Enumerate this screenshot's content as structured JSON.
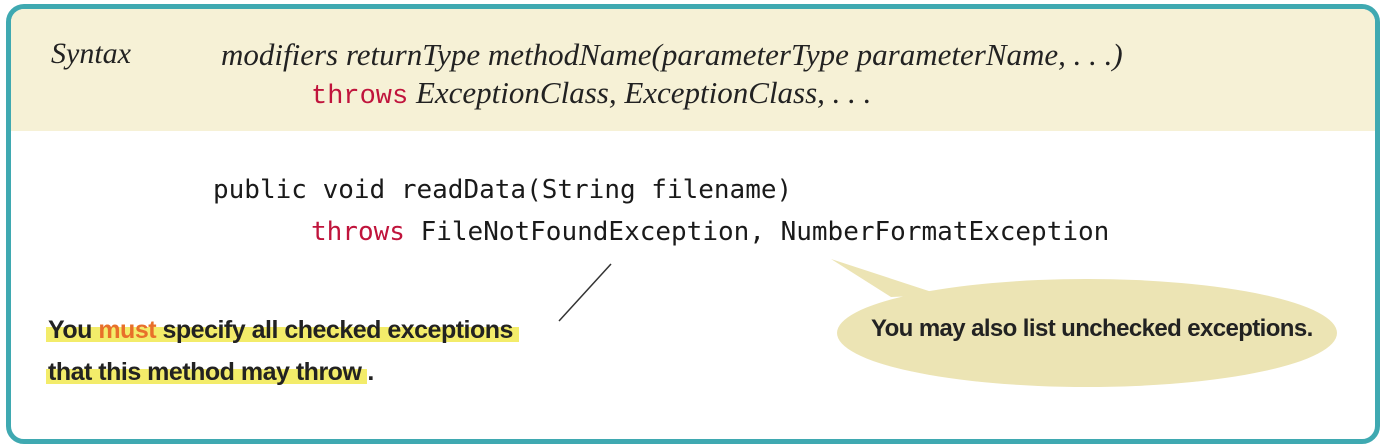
{
  "syntax": {
    "label": "Syntax",
    "line1": "modifiers returnType methodName(parameterType parameterName, . . .)",
    "throws_keyword": "throws",
    "line2_rest": " ExceptionClass, ExceptionClass, . . ."
  },
  "example": {
    "line1": "public void readData(String filename)",
    "throws_keyword": "throws",
    "line2_rest": " FileNotFoundException, NumberFormatException"
  },
  "annotations": {
    "left_before": "You ",
    "left_must": "must",
    "left_after": " specify all checked exceptions",
    "left_line2": "that this method may throw",
    "left_period": ".",
    "right": "You may also list unchecked exceptions."
  },
  "colors": {
    "border": "#3fa9b1",
    "syntax_background": "#f6f1d6",
    "keyword": "#c0143c",
    "highlight": "#f3ec6a",
    "emphasis": "#e8702a",
    "bubble": "#ece4b4"
  }
}
